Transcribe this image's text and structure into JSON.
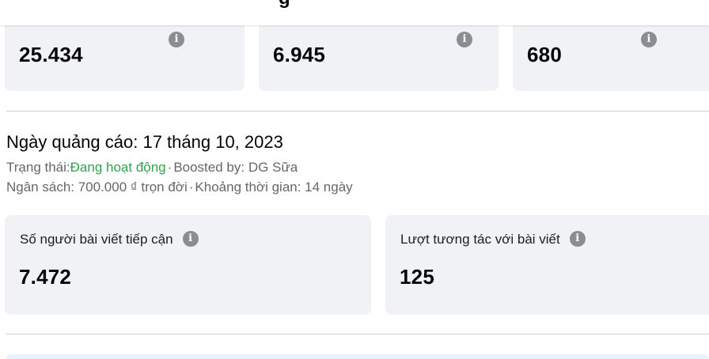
{
  "top_stats": [
    {
      "value": "25.434"
    },
    {
      "value": "6.945"
    },
    {
      "value": "680"
    }
  ],
  "ad": {
    "title": "Ngày quảng cáo: 17 tháng 10, 2023",
    "status_label": "Trạng thái:",
    "status_value": "Đang hoạt động",
    "separator": "·",
    "boosted_by": "Boosted by: DG Sữa",
    "budget": "Ngân sách: 700.000 ₫ trọn đời",
    "duration": "Khoảng thời gian: 14 ngày"
  },
  "ad_stats": [
    {
      "label": "Số người bài viết tiếp cận",
      "value": "7.472"
    },
    {
      "label": "Lượt tương tác với bài viết",
      "value": "125"
    }
  ],
  "icons": {
    "info": "info-icon",
    "info_glyph": "i"
  },
  "colors": {
    "card_bg": "#f0f2f5",
    "status_active": "#31a24c",
    "secondary_text": "#65676b",
    "info_icon": "#8a8d91"
  }
}
